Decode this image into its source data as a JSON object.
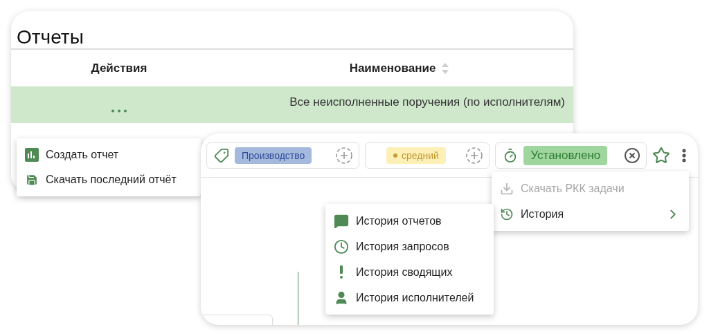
{
  "reports": {
    "title": "Отчеты",
    "columns": [
      {
        "label": "Действия",
        "sortable": false
      },
      {
        "label": "Наименование",
        "sortable": true
      }
    ],
    "rows": [
      {
        "name": "Все неисполненные поручения (по исполнителям)",
        "selected": true
      }
    ],
    "menu": [
      {
        "kind": "chart",
        "label": "Создать отчет"
      },
      {
        "kind": "save",
        "label": "Скачать последний отчёт"
      }
    ]
  },
  "task": {
    "chips": [
      {
        "kind": "category",
        "label": "Производство"
      },
      {
        "kind": "priority",
        "label": "средний"
      },
      {
        "kind": "status",
        "label": "Установлено"
      }
    ],
    "favorite": false,
    "menu": [
      {
        "kind": "download",
        "label": "Скачать РКК задачи",
        "disabled": true
      },
      {
        "kind": "history",
        "label": "История",
        "disabled": false
      }
    ],
    "submenu": [
      {
        "kind": "reports",
        "label": "История отчетов"
      },
      {
        "kind": "requests",
        "label": "История запросов"
      },
      {
        "kind": "summary",
        "label": "История сводящих"
      },
      {
        "kind": "people",
        "label": "История исполнителей"
      }
    ]
  }
}
